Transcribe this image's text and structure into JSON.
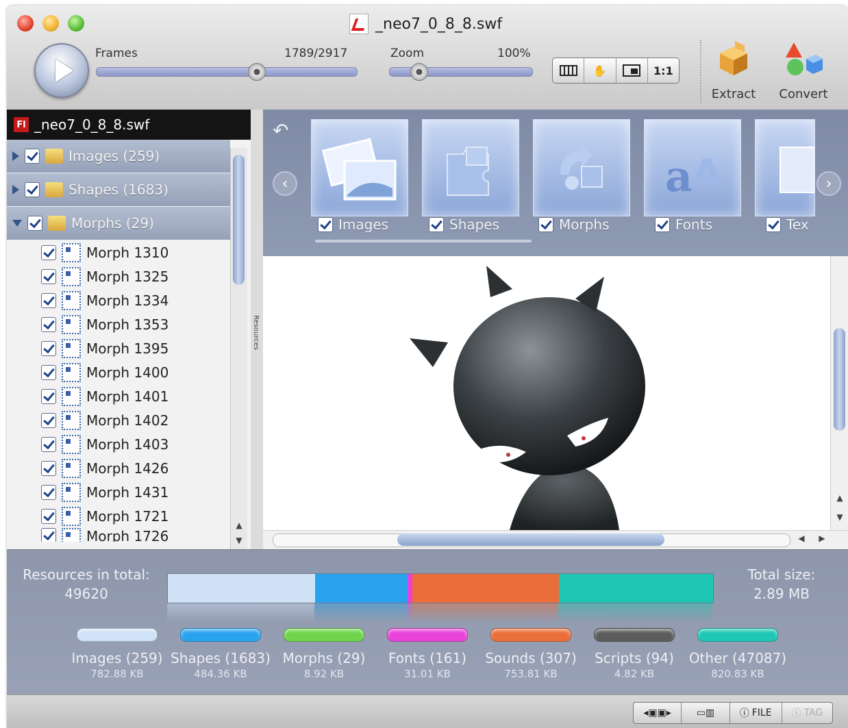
{
  "window": {
    "title": "_neo7_0_8_8.swf"
  },
  "toolbar": {
    "frames_label": "Frames",
    "frames_value": "1789/2917",
    "frames_progress": 0.613,
    "zoom_label": "Zoom",
    "zoom_value": "100%",
    "zoom_progress": 0.2,
    "view_buttons": [
      "film-strip",
      "hand",
      "fit",
      "1:1"
    ],
    "one_to_one_label": "1:1",
    "extract_label": "Extract",
    "convert_label": "Convert"
  },
  "sidebar": {
    "file_badge": "Fl",
    "file_name": "_neo7_0_8_8.swf",
    "categories": [
      {
        "label": "Images (259)",
        "expanded": false
      },
      {
        "label": "Shapes (1683)",
        "expanded": false
      },
      {
        "label": "Morphs (29)",
        "expanded": true
      }
    ],
    "items": [
      "Morph 1310",
      "Morph 1325",
      "Morph 1334",
      "Morph 1353",
      "Morph 1395",
      "Morph 1400",
      "Morph 1401",
      "Morph 1402",
      "Morph 1403",
      "Morph 1426",
      "Morph 1431",
      "Morph 1721",
      "Morph 1726"
    ],
    "splitter_label": "Resources"
  },
  "tiles": [
    {
      "label": "Images"
    },
    {
      "label": "Shapes"
    },
    {
      "label": "Morphs"
    },
    {
      "label": "Fonts"
    },
    {
      "label": "Tex"
    }
  ],
  "stats": {
    "resources_label": "Resources in total:",
    "resources_value": "49620",
    "total_label": "Total size:",
    "total_value": "2.89 MB",
    "bar": [
      {
        "color": "#cfe2f7",
        "share": 0.27
      },
      {
        "color": "#2aa3ee",
        "share": 0.17
      },
      {
        "color": "#e842d8",
        "share": 0.008
      },
      {
        "color": "#ea6e3a",
        "share": 0.27
      },
      {
        "color": "#1dc7b4",
        "share": 0.282
      }
    ],
    "legend": [
      {
        "name": "Images (259)",
        "size": "782.88 KB",
        "color": "#cfe2f7"
      },
      {
        "name": "Shapes (1683)",
        "size": "484.36 KB",
        "color": "#2aa3ee"
      },
      {
        "name": "Morphs (29)",
        "size": "8.92 KB",
        "color": "#6fd44a"
      },
      {
        "name": "Fonts (161)",
        "size": "31.01 KB",
        "color": "#e842d8"
      },
      {
        "name": "Sounds (307)",
        "size": "753.81 KB",
        "color": "#ea6e3a"
      },
      {
        "name": "Scripts (94)",
        "size": "4.82 KB",
        "color": "#5c5c5c"
      },
      {
        "name": "Other (47087)",
        "size": "820.83 KB",
        "color": "#1dc7b4"
      }
    ]
  },
  "statusbar": {
    "file_label": "FILE",
    "tag_label": "TAG"
  }
}
